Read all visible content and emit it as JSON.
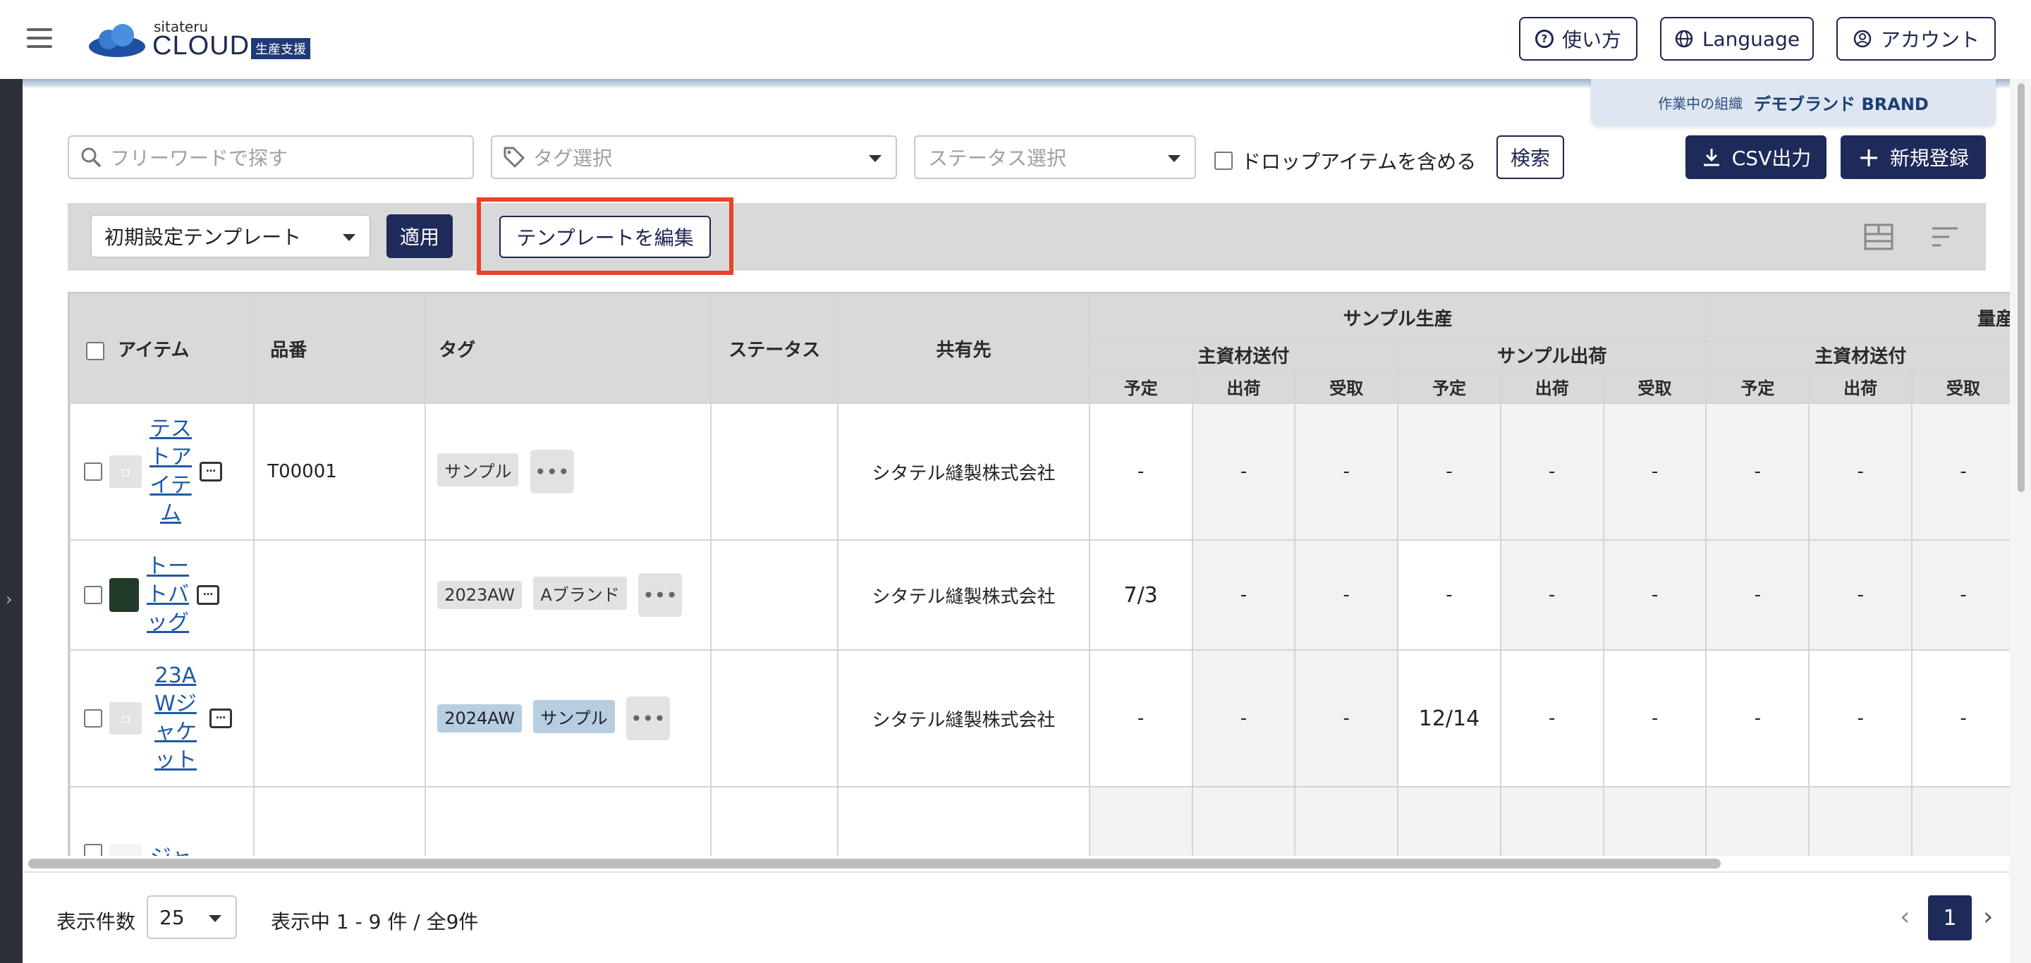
{
  "header": {
    "logo_small": "sitateru",
    "logo_main": "CLOUD",
    "logo_badge": "生産支援",
    "help_label": "使い方",
    "language_label": "Language",
    "account_label": "アカウント"
  },
  "org": {
    "label": "作業中の組織",
    "name": "デモブランド BRAND"
  },
  "filters": {
    "search_placeholder": "フリーワードで探す",
    "tag_placeholder": "タグ選択",
    "status_placeholder": "ステータス選択",
    "drop_items_label": "ドロップアイテムを含める",
    "search_button": "検索",
    "csv_button": "CSV出力",
    "new_button": "新規登録"
  },
  "template": {
    "selected": "初期設定テンプレート",
    "apply_button": "適用",
    "edit_button": "テンプレートを編集"
  },
  "table": {
    "headers": {
      "item": "アイテム",
      "code": "品番",
      "tag": "タグ",
      "status": "ステータス",
      "share": "共有先",
      "sample_group": "サンプル生産",
      "mass_group": "量産",
      "material": "主資材送付",
      "sample_ship": "サンプル出荷",
      "planned": "予定",
      "ship": "出荷",
      "receive": "受取"
    },
    "rows": [
      {
        "item": "テストアイテム",
        "code": "T00001",
        "tags": [
          "サンプル"
        ],
        "share": "シタテル縫製株式会社",
        "dates": [
          "-",
          "-",
          "-",
          "-",
          "-",
          "-",
          "-",
          "-",
          "-"
        ]
      },
      {
        "item": "トートバッグ",
        "code": "",
        "tags": [
          "2023AW",
          "Aブランド"
        ],
        "share": "シタテル縫製株式会社",
        "dates": [
          "7/3",
          "-",
          "-",
          "-",
          "-",
          "-",
          "-",
          "-",
          "-"
        ]
      },
      {
        "item": "23AWジャケット",
        "code": "",
        "tags": [
          "2024AW",
          "サンプル"
        ],
        "share": "シタテル縫製株式会社",
        "dates": [
          "-",
          "-",
          "-",
          "12/14",
          "-",
          "-",
          "-",
          "-",
          "-"
        ]
      },
      {
        "item": "ジャ",
        "code": "",
        "tags": [],
        "share": "",
        "dates": []
      }
    ]
  },
  "footer": {
    "per_page_label": "表示件数",
    "per_page_value": "25",
    "range_text": "表示中 1 - 9 件 / 全9件",
    "current_page": "1"
  }
}
